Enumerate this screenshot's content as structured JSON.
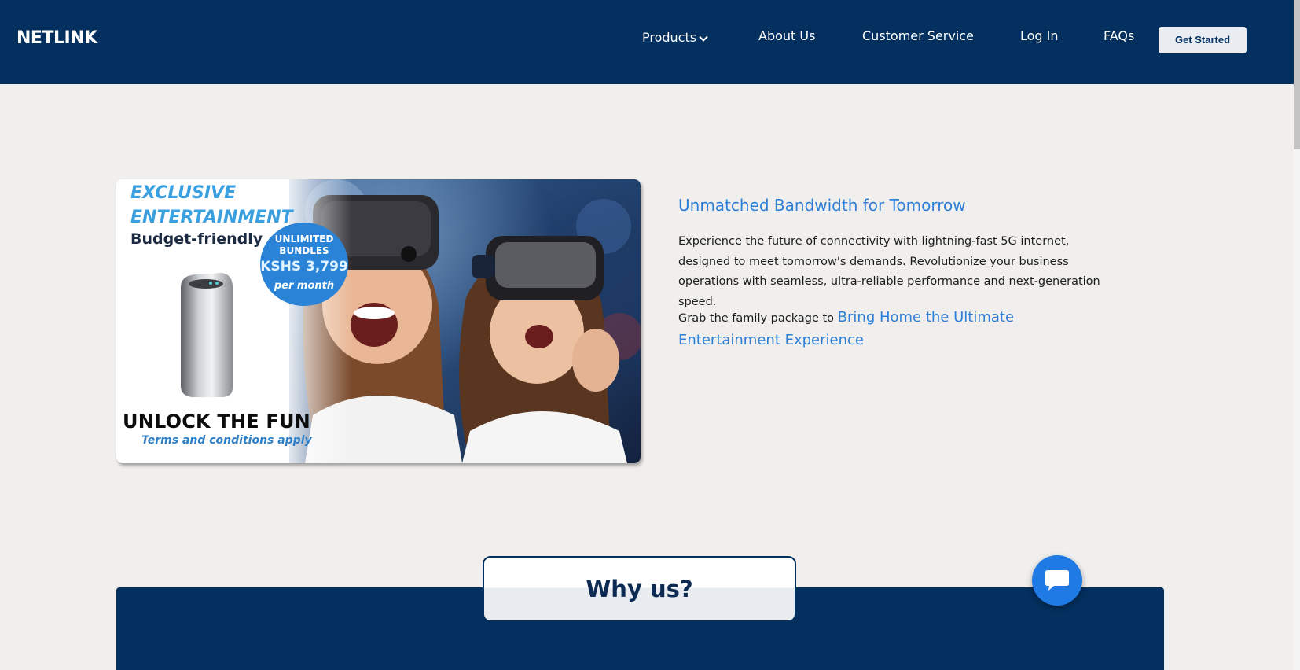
{
  "header": {
    "logo": "NETLINK",
    "nav": {
      "products": "Products",
      "about": "About Us",
      "customer_service": "Customer Service",
      "login": "Log In",
      "faqs": "FAQs"
    },
    "cta": "Get Started"
  },
  "promo": {
    "headline": "EXCLUSIVE ENTERTAINMENT",
    "subheadline": "Budget-friendly",
    "badge_line1": "UNLIMITED BUNDLES",
    "badge_price": "KSHS 3,799",
    "badge_period": "per month",
    "unlock": "UNLOCK THE FUN",
    "terms": "Terms and conditions apply"
  },
  "feature": {
    "title": "Unmatched Bandwidth for Tomorrow",
    "description": "Experience the future of connectivity with lightning-fast 5G internet, designed to meet tomorrow's demands. Revolutionize your business operations with seamless, ultra-reliable performance and next-generation speed.",
    "family_prefix": "Grab the family package to ",
    "family_link": "Bring Home the Ultimate Entertainment Experience"
  },
  "why": {
    "title": "Why us?"
  },
  "colors": {
    "navy": "#03305f",
    "accent_blue": "#2d7fd6",
    "background": "#f0efed"
  }
}
